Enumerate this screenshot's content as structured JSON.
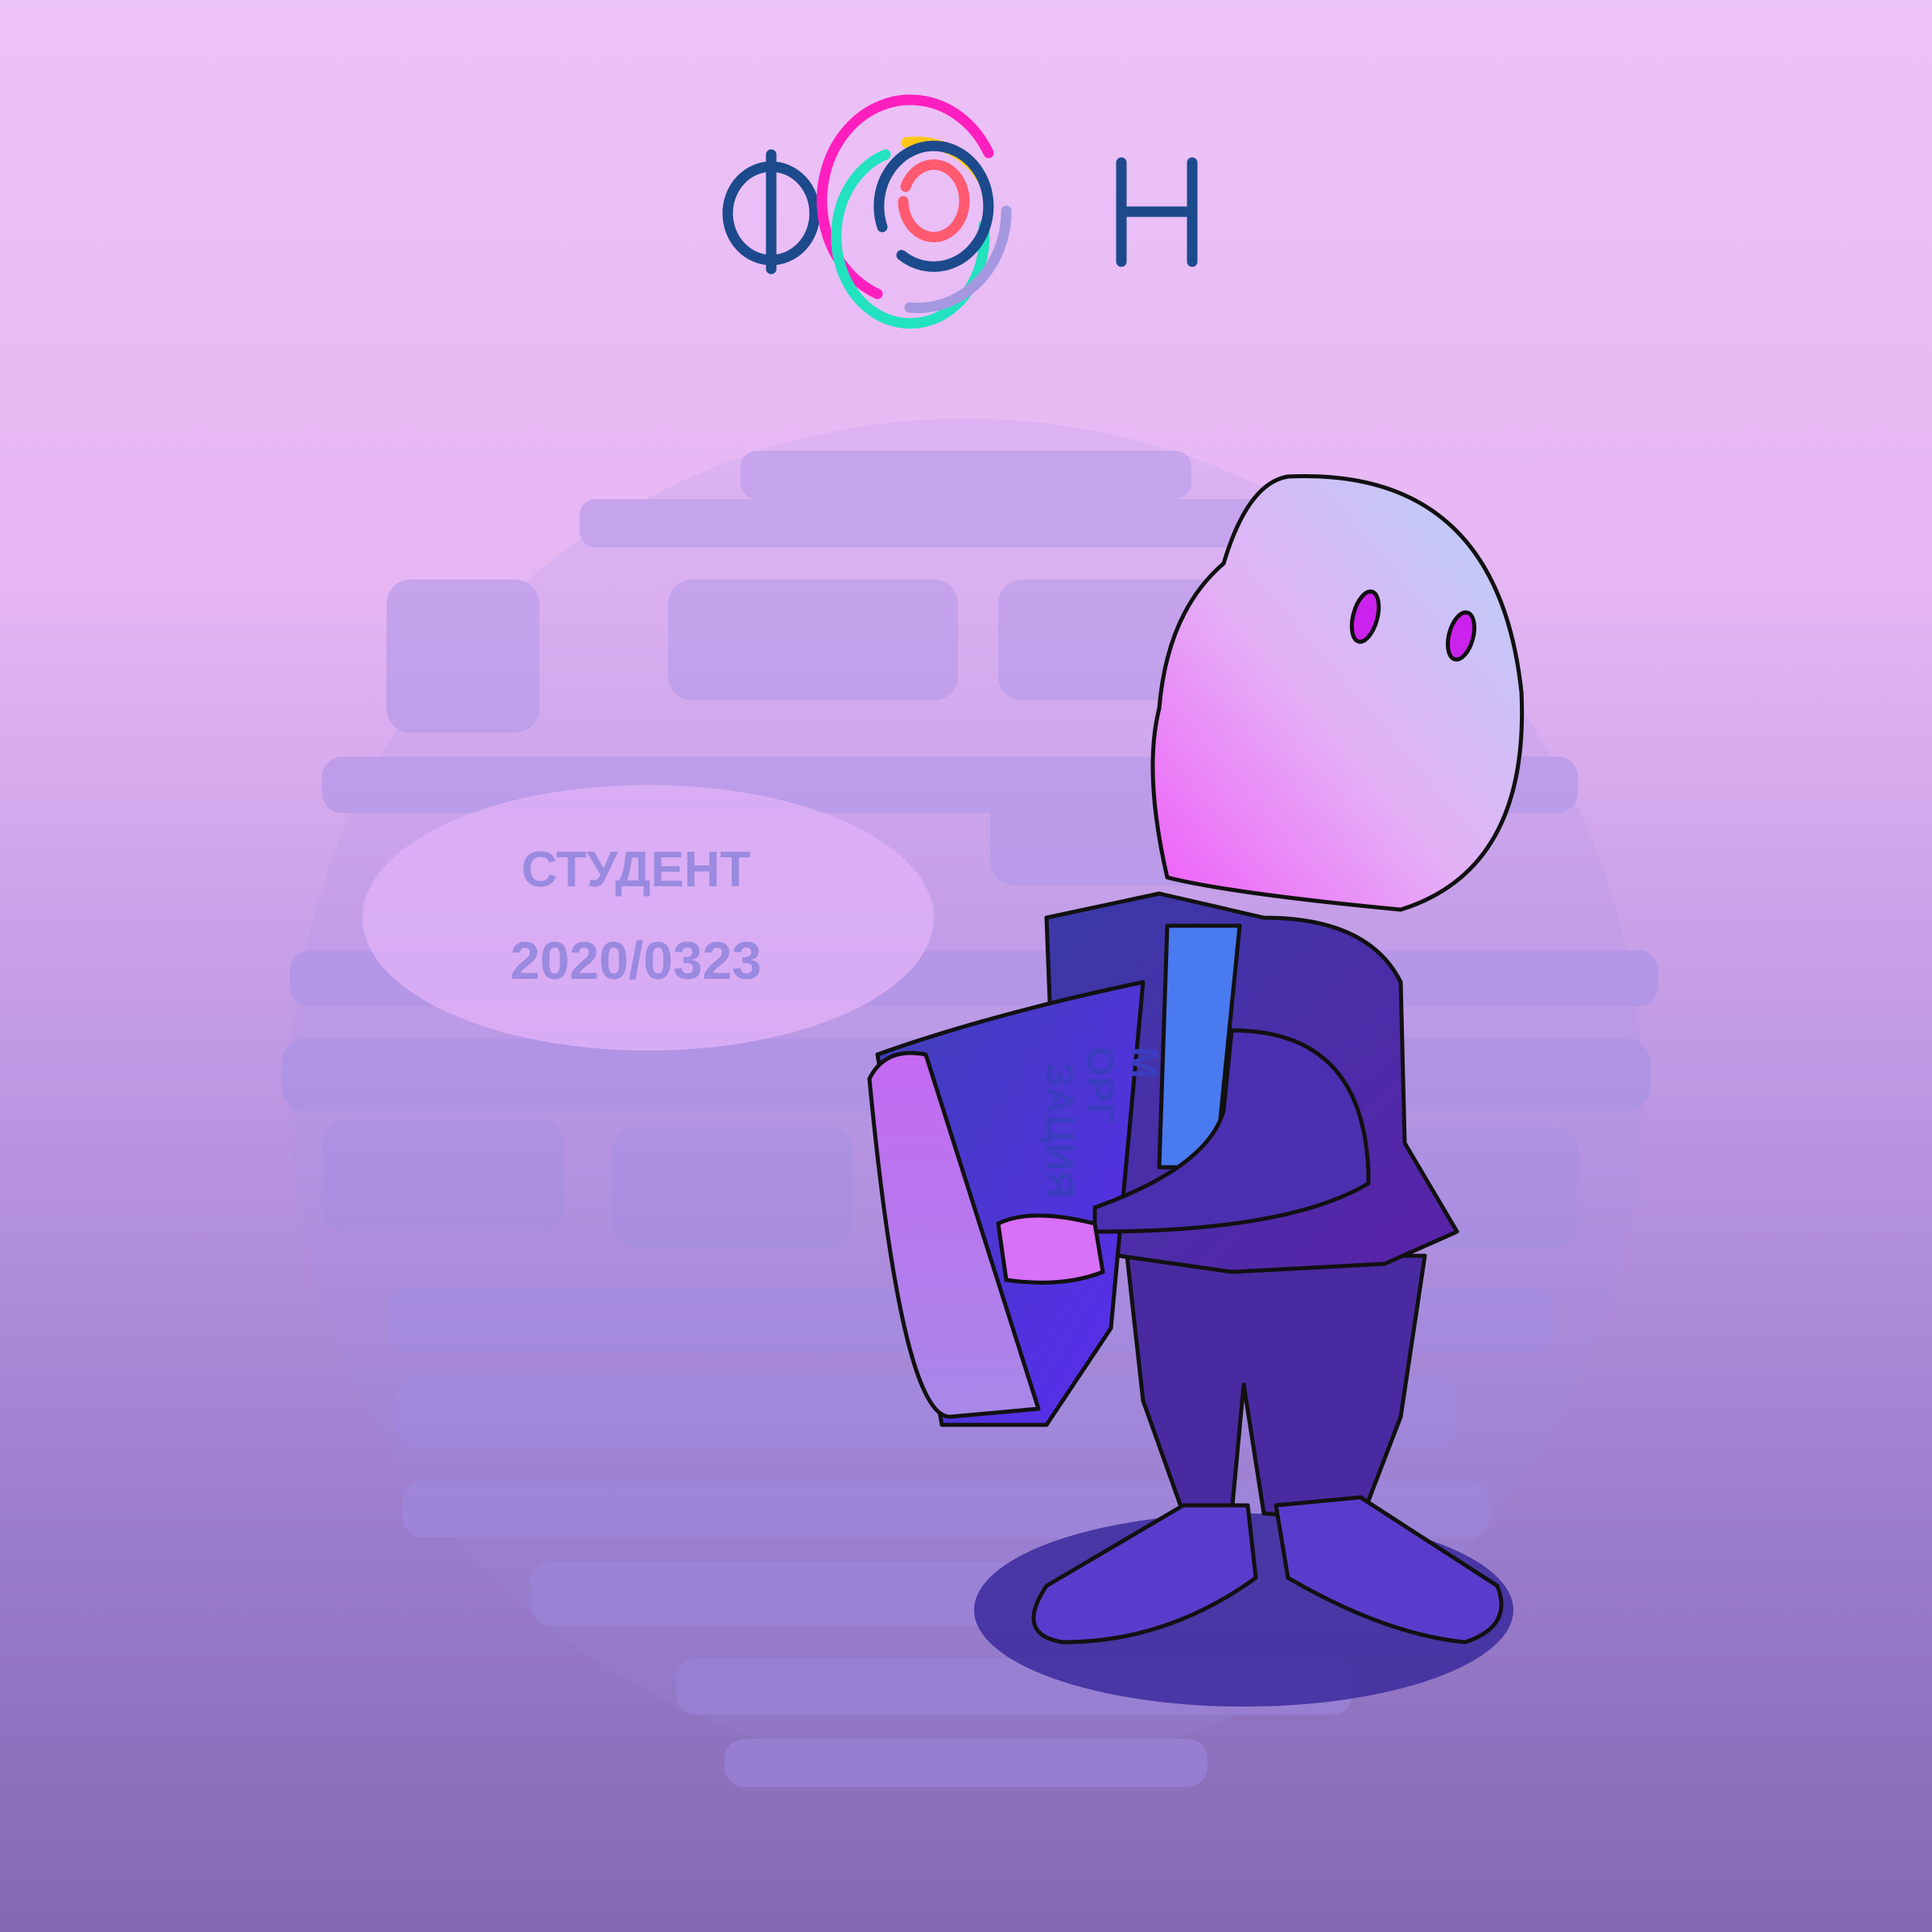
{
  "logo": {
    "text": "ФОН",
    "left_letter": "Ф",
    "right_letter": "Н",
    "colors": {
      "letters": "#1c4a8c",
      "outer_arc": "#ff1fbf",
      "yellow_arc": "#ffc81a",
      "teal_arc": "#22e2c0",
      "inner_arc": "#1c4a8c",
      "core_arc": "#ff5a70",
      "lavender_arc": "#a598e0"
    }
  },
  "badge": {
    "title": "СТУДЕНТ",
    "number": "2020/0323"
  },
  "book": {
    "cover_text": [
      "М",
      "ОРГ",
      "ЗАЦИЯ"
    ]
  },
  "colors": {
    "background_top": "#ecc3f7",
    "background_bottom": "#8469b2",
    "emblem": "#9f8ee6",
    "head": "#e8a8f8",
    "suit": "#4a2fb0"
  }
}
